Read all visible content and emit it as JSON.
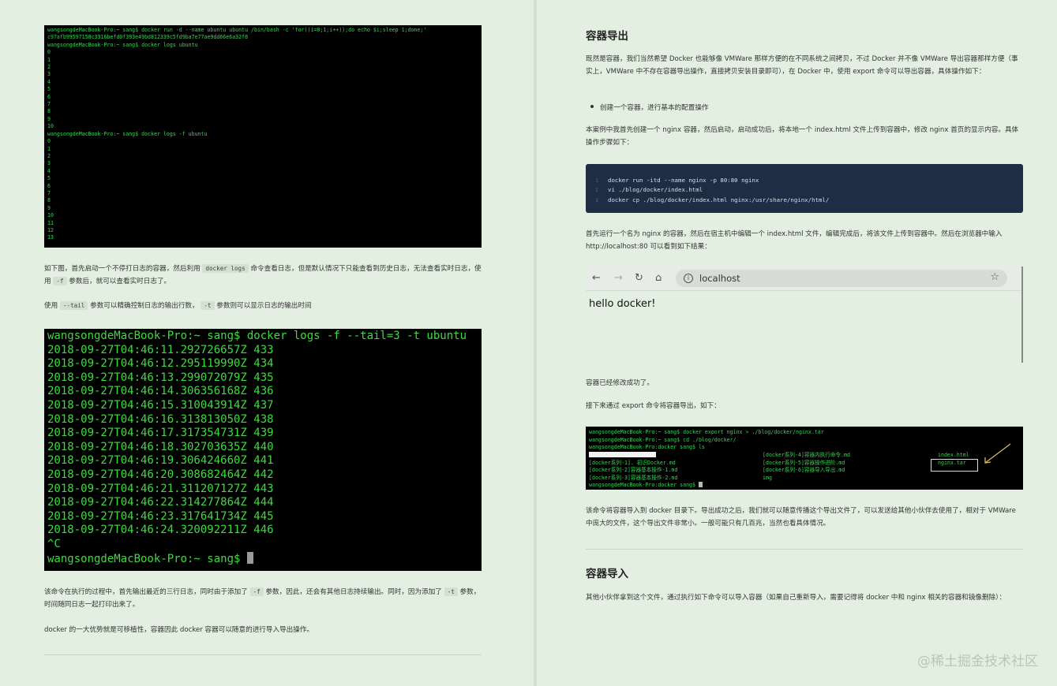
{
  "left": {
    "terminal1": {
      "lines": [
        "wangsongdeMacBook-Pro:~ sang$ docker run -d --name ubuntu ubuntu /bin/bash -c 'for((i=0;1;i++));do echo $i;sleep 1;done;'",
        "c97afb99597158c3316befd0f393e49bd812339c5fd9ba7e77ae9dd66e6a32f8",
        "wangsongdeMacBook-Pro:~ sang$ docker logs ubuntu",
        "0",
        "1",
        "2",
        "3",
        "4",
        "5",
        "6",
        "7",
        "8",
        "9",
        "10",
        "wangsongdeMacBook-Pro:~ sang$ docker logs -f ubuntu",
        "0",
        "1",
        "2",
        "3",
        "4",
        "5",
        "6",
        "7",
        "8",
        "9",
        "10",
        "11",
        "12",
        "13"
      ]
    },
    "para1": {
      "t1": "如下图，首先启动一个不停打日志的容器，然后利用",
      "c1": "docker logs",
      "t2": "命令查看日志，但是默认情况下只能查看到历史日志，无法查看实时日志，使用",
      "c2": "-f",
      "t3": "参数后，就可以查看实时日志了。"
    },
    "para2": {
      "t1": "使用",
      "c1": "--tail",
      "t2": "参数可以精确控制日志的输出行数，",
      "c2": "-t",
      "t3": "参数则可以显示日志的输出时间"
    },
    "terminal2": {
      "prompt": "wangsongdeMacBook-Pro:~ sang$ docker logs -f --tail=3 -t ubuntu",
      "lines": [
        "2018-09-27T04:46:11.292726657Z 433",
        "2018-09-27T04:46:12.295119990Z 434",
        "2018-09-27T04:46:13.299072079Z 435",
        "2018-09-27T04:46:14.306356168Z 436",
        "2018-09-27T04:46:15.310043914Z 437",
        "2018-09-27T04:46:16.313813050Z 438",
        "2018-09-27T04:46:17.317354731Z 439",
        "2018-09-27T04:46:18.302703635Z 440",
        "2018-09-27T04:46:19.306424660Z 441",
        "2018-09-27T04:46:20.308682464Z 442",
        "2018-09-27T04:46:21.311207127Z 443",
        "2018-09-27T04:46:22.314277864Z 444",
        "2018-09-27T04:46:23.317641734Z 445",
        "2018-09-27T04:46:24.320092211Z 446",
        "^C"
      ],
      "final_prompt": "wangsongdeMacBook-Pro:~ sang$ "
    },
    "para3": {
      "t1": "该命令在执行的过程中，首先输出最近的三行日志，同时由于添加了",
      "c1": "-f",
      "t2": "参数，因此，还会有其他日志持续输出。同时，因为添加了",
      "c2": "-t",
      "t3": "参数，时间随同日志一起打印出来了。"
    },
    "para4": "docker 的一大优势就是可移植性，容器因此 docker 容器可以随意的进行导入导出操作。"
  },
  "right": {
    "h_export": "容器导出",
    "para1": "既然是容器，我们当然希望 Docker 也能够像 VMWare 那样方便的在不同系统之间拷贝，不过 Docker 并不像 VMWare 导出容器那样方便（事实上，VMWare 中不存在容器导出操作，直接拷贝安装目录即可），在 Docker 中，使用 export 命令可以导出容器，具体操作如下：",
    "bullet1": "创建一个容器，进行基本的配置操作",
    "para2": "本案例中我首先创建一个 nginx 容器，然后启动，启动成功后，将本地一个 index.html 文件上传到容器中，修改 nginx 首页的显示内容。具体操作步骤如下：",
    "code": [
      {
        "num": "1",
        "text": "docker run -itd --name nginx -p 80:80 nginx"
      },
      {
        "num": "2",
        "text": "vi ./blog/docker/index.html"
      },
      {
        "num": "3",
        "text": "docker cp ./blog/docker/index.html nginx:/usr/share/nginx/html/"
      }
    ],
    "para3": "首先运行一个名为 nginx 的容器，然后在宿主机中编辑一个 index.html 文件，编辑完成后，将该文件上传到容器中。然后在浏览器中输入 http://localhost:80 可以看到如下结果：",
    "browser": {
      "back": "←",
      "forward": "→",
      "reload": "↻",
      "home": "⌂",
      "info": "i",
      "host": "localhost",
      "star": "☆",
      "content": "hello docker!"
    },
    "para4": "容器已经修改成功了。",
    "para5": "接下来通过 export 命令将容器导出，如下：",
    "terminal3": {
      "line1": "wangsongdeMacBook-Pro:~ sang$ docker export nginx > ./blog/docker/nginx.tar",
      "line2": "wangsongdeMacBook-Pro:~ sang$ cd ./blog/docker/",
      "line3": "wangsongdeMacBook-Pro:docker sang$ ls",
      "files_col1": [
        "[docker系列-1]. 初识Docker.md",
        "[docker系列-2]容器基本操作-1.md",
        "[docker系列-3]容器基本操作-2.md"
      ],
      "files_col2": [
        "[docker系列-4]容器内执行命令.md",
        "[docker系列-5]容器操作进阶.md",
        "[docker系列-6]容器导入导出.md",
        "img"
      ],
      "files_col3": [
        "index.html",
        "nginx.tar"
      ],
      "last_prompt": "wangsongdeMacBook-Pro:docker sang$ "
    },
    "para6": "该命令将容器导入到 docker 目录下。导出成功之后，我们就可以随意传播这个导出文件了，可以发送给其他小伙伴去使用了，相对于 VMWare 中庞大的文件，这个导出文件非常小。一般可能只有几百兆，当然也看具体情况。",
    "h_import": "容器导入",
    "para7": "其他小伙伴拿到这个文件，通过执行如下命令可以导入容器（如果自己重新导入，需要记得将 docker 中和 nginx 相关的容器和镜像删除）："
  },
  "watermark": "@稀土掘金技术社区"
}
